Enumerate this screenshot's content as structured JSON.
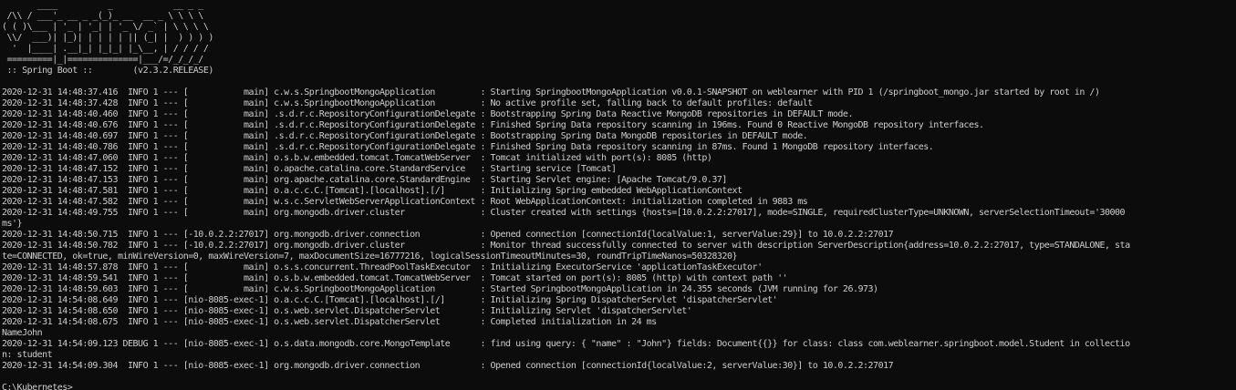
{
  "console": {
    "lines": [
      "       ____          _            __ _ _",
      " /\\\\ / ___'_ __ _ _(_)_ __  __ _ \\ \\ \\ \\",
      "( ( )\\___ | '_ | '_| | '_ \\/ _` | \\ \\ \\ \\",
      " \\\\/  ___)| |_)| | | | | || (_| |  ) ) ) )",
      "  '  |____| .__|_| |_|_| |_\\__, | / / / /",
      " =========|_|==============|___/=/_/_/_/",
      " :: Spring Boot ::        (v2.3.2.RELEASE)",
      "",
      "2020-12-31 14:48:37.416  INFO 1 --- [           main] c.w.s.SpringbootMongoApplication         : Starting SpringbootMongoApplication v0.0.1-SNAPSHOT on weblearner with PID 1 (/springboot_mongo.jar started by root in /)",
      "2020-12-31 14:48:37.428  INFO 1 --- [           main] c.w.s.SpringbootMongoApplication         : No active profile set, falling back to default profiles: default",
      "2020-12-31 14:48:40.460  INFO 1 --- [           main] .s.d.r.c.RepositoryConfigurationDelegate : Bootstrapping Spring Data Reactive MongoDB repositories in DEFAULT mode.",
      "2020-12-31 14:48:40.676  INFO 1 --- [           main] .s.d.r.c.RepositoryConfigurationDelegate : Finished Spring Data repository scanning in 196ms. Found 0 Reactive MongoDB repository interfaces.",
      "2020-12-31 14:48:40.697  INFO 1 --- [           main] .s.d.r.c.RepositoryConfigurationDelegate : Bootstrapping Spring Data MongoDB repositories in DEFAULT mode.",
      "2020-12-31 14:48:40.786  INFO 1 --- [           main] .s.d.r.c.RepositoryConfigurationDelegate : Finished Spring Data repository scanning in 87ms. Found 1 MongoDB repository interfaces.",
      "2020-12-31 14:48:47.060  INFO 1 --- [           main] o.s.b.w.embedded.tomcat.TomcatWebServer  : Tomcat initialized with port(s): 8085 (http)",
      "2020-12-31 14:48:47.152  INFO 1 --- [           main] o.apache.catalina.core.StandardService   : Starting service [Tomcat]",
      "2020-12-31 14:48:47.153  INFO 1 --- [           main] org.apache.catalina.core.StandardEngine  : Starting Servlet engine: [Apache Tomcat/9.0.37]",
      "2020-12-31 14:48:47.581  INFO 1 --- [           main] o.a.c.c.C.[Tomcat].[localhost].[/]       : Initializing Spring embedded WebApplicationContext",
      "2020-12-31 14:48:47.582  INFO 1 --- [           main] w.s.c.ServletWebServerApplicationContext : Root WebApplicationContext: initialization completed in 9883 ms",
      "2020-12-31 14:48:49.755  INFO 1 --- [           main] org.mongodb.driver.cluster               : Cluster created with settings {hosts=[10.0.2.2:27017], mode=SINGLE, requiredClusterType=UNKNOWN, serverSelectionTimeout='30000",
      "ms'}",
      "2020-12-31 14:48:50.715  INFO 1 --- [-10.0.2.2:27017] org.mongodb.driver.connection            : Opened connection [connectionId{localValue:1, serverValue:29}] to 10.0.2.2:27017",
      "2020-12-31 14:48:50.782  INFO 1 --- [-10.0.2.2:27017] org.mongodb.driver.cluster               : Monitor thread successfully connected to server with description ServerDescription{address=10.0.2.2:27017, type=STANDALONE, sta",
      "te=CONNECTED, ok=true, minWireVersion=0, maxWireVersion=7, maxDocumentSize=16777216, logicalSessionTimeoutMinutes=30, roundTripTimeNanos=50328320}",
      "2020-12-31 14:48:57.878  INFO 1 --- [           main] o.s.s.concurrent.ThreadPoolTaskExecutor  : Initializing ExecutorService 'applicationTaskExecutor'",
      "2020-12-31 14:48:59.541  INFO 1 --- [           main] o.s.b.w.embedded.tomcat.TomcatWebServer  : Tomcat started on port(s): 8085 (http) with context path ''",
      "2020-12-31 14:48:59.603  INFO 1 --- [           main] c.w.s.SpringbootMongoApplication         : Started SpringbootMongoApplication in 24.355 seconds (JVM running for 26.973)",
      "2020-12-31 14:54:08.649  INFO 1 --- [nio-8085-exec-1] o.a.c.c.C.[Tomcat].[localhost].[/]       : Initializing Spring DispatcherServlet 'dispatcherServlet'",
      "2020-12-31 14:54:08.650  INFO 1 --- [nio-8085-exec-1] o.s.web.servlet.DispatcherServlet        : Initializing Servlet 'dispatcherServlet'",
      "2020-12-31 14:54:08.675  INFO 1 --- [nio-8085-exec-1] o.s.web.servlet.DispatcherServlet        : Completed initialization in 24 ms",
      "NameJohn",
      "2020-12-31 14:54:09.123 DEBUG 1 --- [nio-8085-exec-1] o.s.data.mongodb.core.MongoTemplate      : find using query: { \"name\" : \"John\"} fields: Document{{}} for class: class com.weblearner.springboot.model.Student in collectio",
      "n: student",
      "2020-12-31 14:54:09.304  INFO 1 --- [nio-8085-exec-1] org.mongodb.driver.connection            : Opened connection [connectionId{localValue:2, serverValue:30}] to 10.0.2.2:27017",
      "",
      "C:\\Kubernetes>"
    ],
    "colors": {
      "background": "#0c0c0c",
      "foreground": "#cccccc"
    }
  }
}
